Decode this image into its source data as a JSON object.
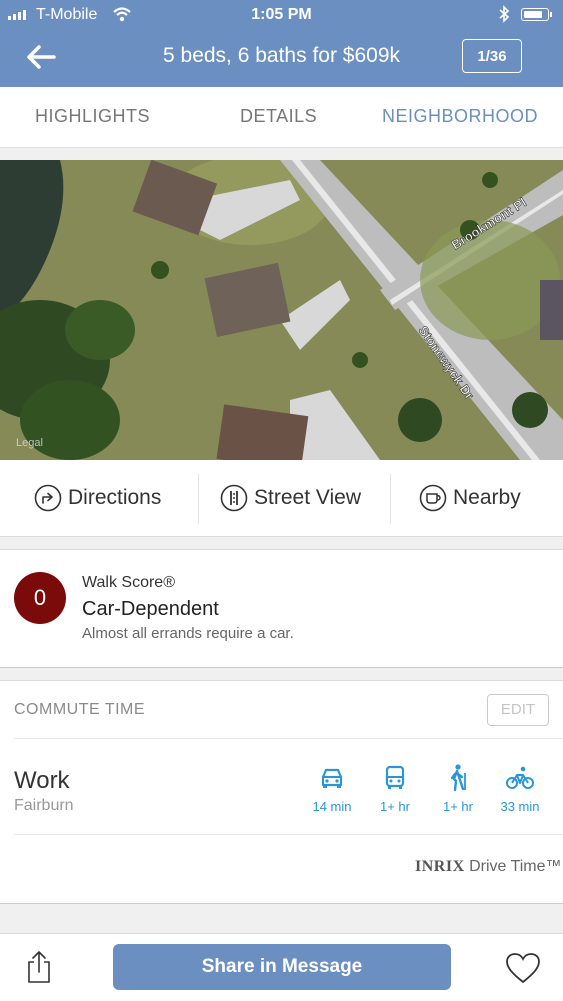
{
  "status_bar": {
    "carrier": "T-Mobile",
    "time": "1:05 PM",
    "battery_level": 0.85
  },
  "header": {
    "title": "5 beds, 6 baths for $609k",
    "photo_counter": "1/36"
  },
  "tabs": [
    {
      "label": "HIGHLIGHTS",
      "active": false
    },
    {
      "label": "DETAILS",
      "active": false
    },
    {
      "label": "NEIGHBORHOOD",
      "active": true
    }
  ],
  "map": {
    "street_1": "Brookmont Pl",
    "street_2": "Stonewyck Dr",
    "legal_label": "Legal"
  },
  "actions": {
    "directions": "Directions",
    "street_view": "Street View",
    "nearby": "Nearby"
  },
  "walk_score": {
    "label": "Walk Score®",
    "score": "0",
    "category": "Car-Dependent",
    "description": "Almost all errands require a car.",
    "color": "#7b0a0a"
  },
  "commute": {
    "header": "COMMUTE TIME",
    "edit_label": "EDIT",
    "destination": "Work",
    "destination_sub": "Fairburn",
    "modes": [
      {
        "icon": "car-icon",
        "time": "14 min"
      },
      {
        "icon": "bus-icon",
        "time": "1+ hr"
      },
      {
        "icon": "walk-icon",
        "time": "1+ hr"
      },
      {
        "icon": "bike-icon",
        "time": "33 min"
      }
    ],
    "provider_brand": "INRIX",
    "provider_text": "Drive Time™"
  },
  "bottom_bar": {
    "share_label": "Share in Message"
  },
  "colors": {
    "accent": "#6c8fc1",
    "commute_icons": "#2a95d8"
  }
}
